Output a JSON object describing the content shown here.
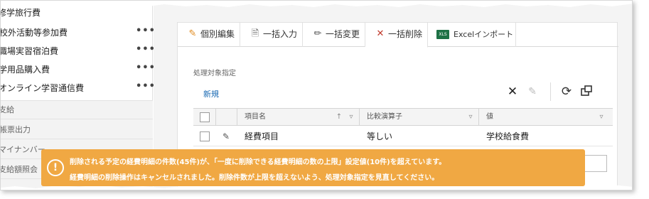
{
  "sidebar": {
    "items": [
      {
        "label": "修学旅行費"
      },
      {
        "label": "校外活動等参加費"
      },
      {
        "label": "職場実習宿泊費"
      },
      {
        "label": "学用品購入費"
      },
      {
        "label": "オンライン学習通信費"
      }
    ],
    "more_label": "•••",
    "sections": [
      {
        "label": "支給"
      },
      {
        "label": "帳票出力"
      },
      {
        "label": "マイナンバー"
      },
      {
        "label": "支給額照会"
      }
    ]
  },
  "tabs": [
    {
      "label": "個別編集",
      "icon": "edit-icon"
    },
    {
      "label": "一括入力",
      "icon": "document-icon"
    },
    {
      "label": "一括変更",
      "icon": "pencil-icon"
    },
    {
      "label": "一括削除",
      "icon": "delete-x-icon",
      "active": true
    },
    {
      "label": "Excelインポート",
      "icon": "excel-icon"
    }
  ],
  "main": {
    "section_label": "処理対象指定",
    "new_link": "新規"
  },
  "grid": {
    "headers": {
      "item_name": "項目名",
      "operator": "比較演算子",
      "value": "値"
    },
    "rows": [
      {
        "item_name": "経費項目",
        "operator": "等しい",
        "value": "学校給食費"
      }
    ]
  },
  "toast": {
    "line1": "削除される予定の経費明細の件数(45件)が、「一度に削除できる経費明細の数の上限」設定値(10件)を超えています。",
    "line2": "経費明細の削除操作はキャンセルされました。削除件数が上限を超えないよう、処理対象指定を見直してください。",
    "color": "#f0a843"
  },
  "colors": {
    "link": "#1a6ab3",
    "delete_red": "#c0392b",
    "excel_green": "#1e7145",
    "edit_orange": "#e08a1e"
  }
}
